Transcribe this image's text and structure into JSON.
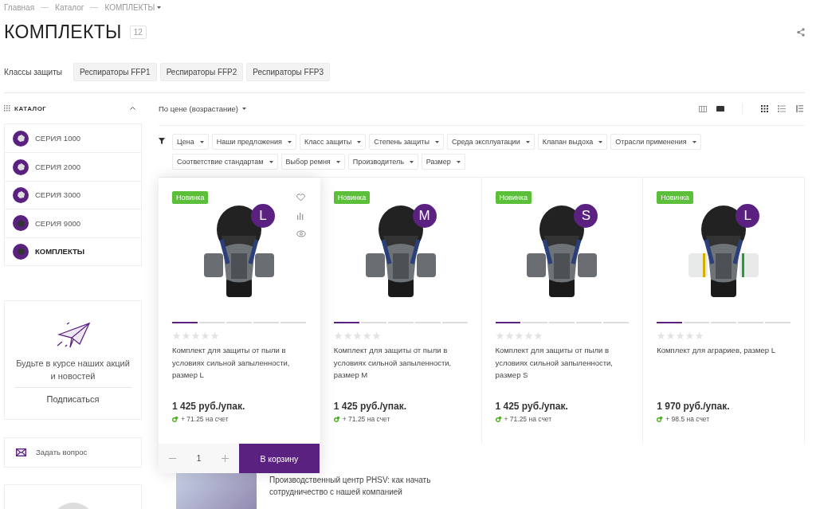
{
  "breadcrumbs": [
    {
      "label": "Главная"
    },
    {
      "label": "Каталог"
    },
    {
      "label": "КОМПЛЕКТЫ",
      "dropdown": true
    }
  ],
  "title": "КОМПЛЕКТЫ",
  "count": "12",
  "tags": {
    "label": "Классы защиты",
    "items": [
      "Респираторы FFP1",
      "Респираторы FFP2",
      "Респираторы FFP3"
    ]
  },
  "sidebar": {
    "heading": "КАТАЛОГ",
    "expanded": true,
    "items": [
      {
        "label": "СЕРИЯ 1000",
        "selected": false
      },
      {
        "label": "СЕРИЯ 2000",
        "selected": false
      },
      {
        "label": "СЕРИЯ 3000",
        "selected": false
      },
      {
        "label": "СЕРИЯ 9000",
        "selected": false
      },
      {
        "label": "КОМПЛЕКТЫ",
        "selected": true
      }
    ],
    "subscribe": {
      "text": "Будьте в курсе наших акций и новостей",
      "button": "Подписаться"
    },
    "ask": "Задать вопрос"
  },
  "sort": {
    "label": "По цене (возрастание)",
    "views": [
      {
        "kind": "columns",
        "selected": false
      },
      {
        "kind": "block",
        "selected": true
      }
    ],
    "layouts": [
      {
        "kind": "grid",
        "selected": true
      },
      {
        "kind": "list",
        "selected": false
      },
      {
        "kind": "table",
        "selected": false
      }
    ]
  },
  "filters": [
    "Цена",
    "Наши предложения",
    "Класс защиты",
    "Степень защиты",
    "Среда эксплуатации",
    "Клапан выдоха",
    "Отрасли применения",
    "Соответствие стандартам",
    "Выбор ремня",
    "Производитель",
    "Размер"
  ],
  "products": [
    {
      "badge": "Новинка",
      "size": "L",
      "kind": "grey",
      "hovered": true,
      "stars": 0,
      "gallery": [
        {
          "selected": true
        },
        {
          "selected": false
        },
        {
          "selected": false
        },
        {
          "selected": false
        },
        {
          "selected": false
        }
      ],
      "name": "Комплект для защиты от пыли в условиях сильной запыленности, размер L",
      "price": "1 425 руб./упак.",
      "bonus": "+ 71.25 на счет",
      "quantity": "1",
      "cart": "В корзину"
    },
    {
      "badge": "Новинка",
      "size": "M",
      "kind": "grey",
      "hovered": false,
      "stars": 0,
      "gallery": [
        {
          "selected": true
        },
        {
          "selected": false
        },
        {
          "selected": false
        },
        {
          "selected": false
        },
        {
          "selected": false
        }
      ],
      "name": "Комплект для защиты от пыли в условиях сильной запыленности, размер M",
      "price": "1 425 руб./упак.",
      "bonus": "+ 71.25 на счет"
    },
    {
      "badge": "Новинка",
      "size": "S",
      "kind": "grey",
      "hovered": false,
      "stars": 0,
      "gallery": [
        {
          "selected": true
        },
        {
          "selected": false
        },
        {
          "selected": false
        },
        {
          "selected": false
        },
        {
          "selected": false
        }
      ],
      "name": "Комплект для защиты от пыли в условиях сильной запыленности, размер S",
      "price": "1 425 руб./упак.",
      "bonus": "+ 71.25 на счет"
    },
    {
      "badge": "Новинка",
      "size": "L",
      "kind": "color",
      "hovered": false,
      "stars": 0,
      "gallery": [
        {
          "selected": true
        },
        {
          "selected": false
        },
        {
          "selected": false
        },
        {
          "selected": false
        },
        {
          "selected": false
        }
      ],
      "name": "Комплект для аграриев, размер L",
      "price": "1 970 руб./упак.",
      "bonus": "+ 98.5 на счет"
    }
  ],
  "news": {
    "title": "Производственный центр PHSV: как начать сотрудничество с нашей компанией"
  }
}
